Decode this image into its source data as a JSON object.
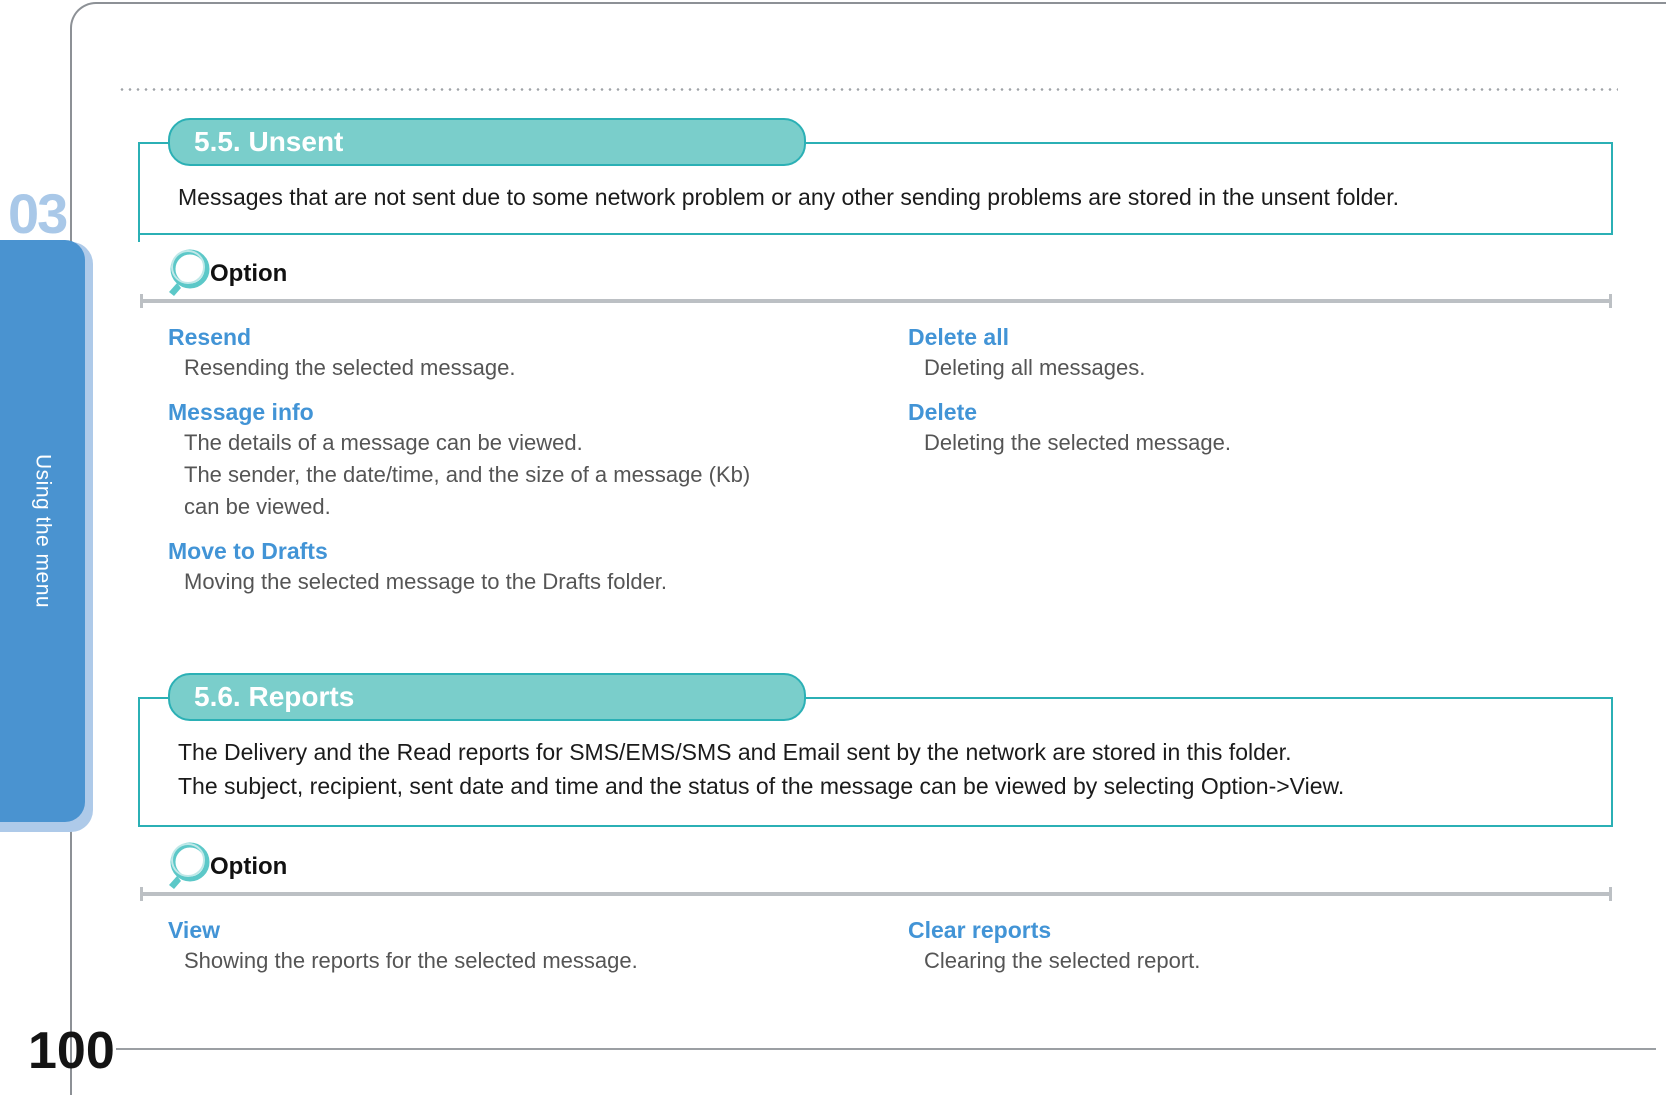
{
  "page": {
    "number": "100",
    "chapter_number": "03",
    "chapter_label": "Using the menu"
  },
  "sections": [
    {
      "id": "unsent",
      "title": "5.5. Unsent",
      "body_lines": [
        "Messages that are not sent due to some network problem or any other sending problems are stored in the unsent folder."
      ],
      "option_label": "Option",
      "option_icon": "magnifier-icon",
      "options_left": [
        {
          "title": "Resend",
          "desc_lines": [
            "Resending the selected message."
          ]
        },
        {
          "title": "Message info",
          "desc_lines": [
            "The details of a message can be viewed.",
            "The sender, the date/time, and the size of a message (Kb)",
            "can be viewed."
          ]
        },
        {
          "title": "Move to Drafts",
          "desc_lines": [
            "Moving the selected message to the Drafts folder."
          ]
        }
      ],
      "options_right": [
        {
          "title": "Delete all",
          "desc_lines": [
            "Deleting all messages."
          ]
        },
        {
          "title": "Delete",
          "desc_lines": [
            "Deleting the selected message."
          ]
        }
      ]
    },
    {
      "id": "reports",
      "title": "5.6. Reports",
      "body_lines": [
        "The Delivery and the Read reports for SMS/EMS/SMS and Email sent by the network are stored in this folder.",
        "The subject, recipient, sent date and time and the status of the message can be viewed by selecting Option->View."
      ],
      "option_label": "Option",
      "option_icon": "magnifier-icon",
      "options_left": [
        {
          "title": "View",
          "desc_lines": [
            "Showing the reports for the selected message."
          ]
        }
      ],
      "options_right": [
        {
          "title": "Clear reports",
          "desc_lines": [
            "Clearing the selected report."
          ]
        }
      ]
    }
  ],
  "colors": {
    "pill_fill": "#7acecb",
    "pill_border": "#2bb0b5",
    "option_title": "#4294d6",
    "tab_blue": "#4a93d0",
    "tab_shadow": "#aecae9",
    "chapter_number": "#a9c8e8"
  }
}
